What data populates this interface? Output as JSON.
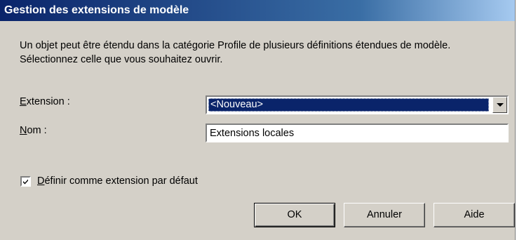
{
  "dialog": {
    "title": "Gestion des extensions de modèle",
    "description": "Un objet peut être étendu dans la catégorie Profile de plusieurs définitions étendues de modèle. Sélectionnez celle que vous souhaitez ouvrir."
  },
  "form": {
    "extension_label_accel": "E",
    "extension_label_rest": "xtension :",
    "extension_value": "<Nouveau>",
    "name_label_accel": "N",
    "name_label_rest": "om :",
    "name_value": "Extensions locales",
    "default_checkbox_accel": "D",
    "default_checkbox_rest": "éfinir comme extension par défaut",
    "default_checked": true
  },
  "buttons": {
    "ok": "OK",
    "cancel": "Annuler",
    "help": "Aide"
  },
  "colors": {
    "title_bar": "#0a246a",
    "face": "#d4d0c8",
    "selection": "#0a246a"
  }
}
